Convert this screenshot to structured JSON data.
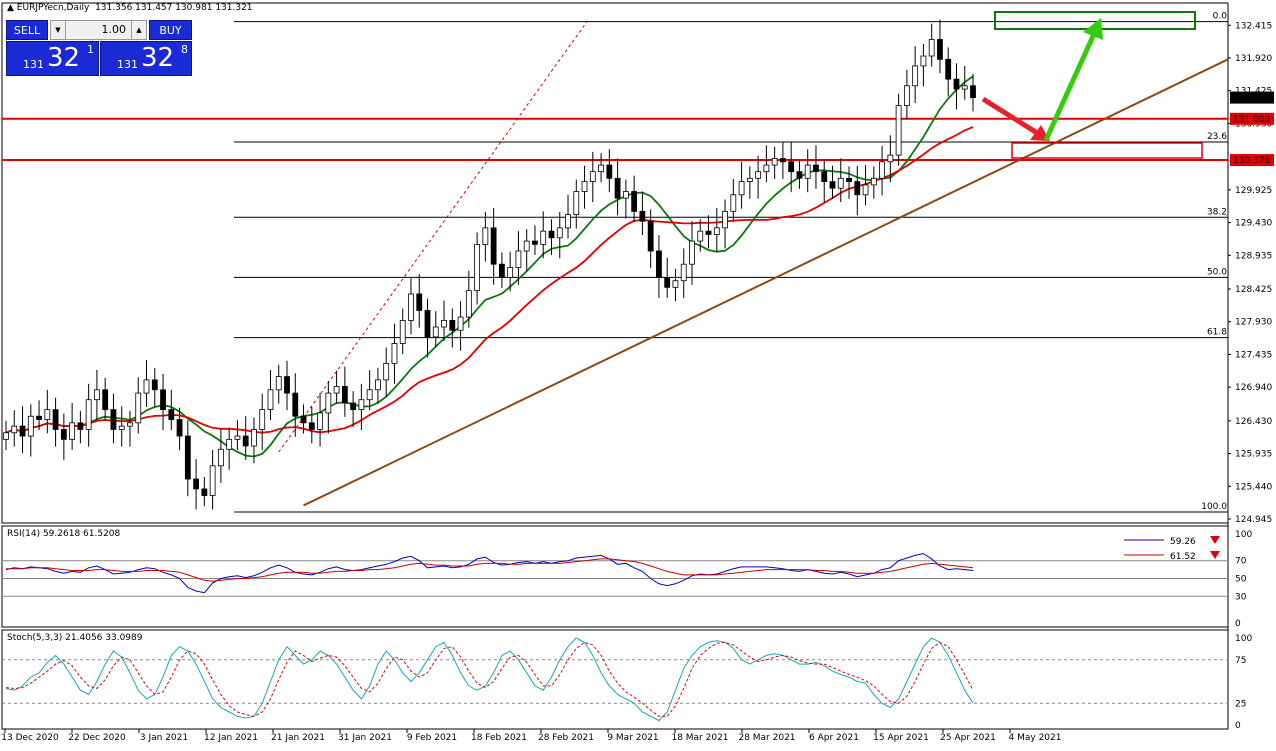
{
  "header": {
    "symbol": "EURJPYecn,Daily",
    "ohlc": "131.356 131.457 130.981 131.321"
  },
  "trade_panel": {
    "sell_label": "SELL",
    "buy_label": "BUY",
    "lot_value": "1.00",
    "bid_prefix": "131",
    "bid_big": "32",
    "bid_sup": "1",
    "ask_prefix": "131",
    "ask_big": "32",
    "ask_sup": "8"
  },
  "chart_data": [
    {
      "type": "candlestick",
      "name": "main",
      "y_ticks": [
        "132.415",
        "131.920",
        "131.425",
        "130.930",
        "129.925",
        "129.430",
        "128.935",
        "128.425",
        "127.930",
        "127.435",
        "126.940",
        "126.430",
        "125.935",
        "125.440",
        "124.945"
      ],
      "ylim": [
        124.9,
        132.6
      ],
      "x_ticks": [
        "13 Dec 2020",
        "22 Dec 2020",
        "3 Jan 2021",
        "12 Jan 2021",
        "21 Jan 2021",
        "31 Jan 2021",
        "9 Feb 2021",
        "18 Feb 2021",
        "28 Feb 2021",
        "9 Mar 2021",
        "18 Mar 2021",
        "28 Mar 2021",
        "6 Apr 2021",
        "15 Apr 2021",
        "25 Apr 2021",
        "4 May 2021"
      ],
      "last_price": "131.321",
      "close": [
        126.25,
        126.35,
        126.2,
        126.5,
        126.45,
        126.6,
        126.3,
        126.15,
        126.4,
        126.3,
        126.75,
        126.9,
        126.6,
        126.3,
        126.35,
        126.4,
        126.85,
        127.05,
        126.9,
        126.6,
        126.45,
        126.2,
        125.55,
        125.4,
        125.3,
        125.75,
        126.0,
        126.15,
        126.2,
        126.05,
        126.3,
        126.6,
        126.9,
        127.1,
        126.85,
        126.5,
        126.4,
        126.3,
        126.55,
        126.85,
        126.95,
        126.7,
        126.6,
        126.75,
        126.9,
        127.05,
        127.3,
        127.6,
        127.95,
        128.35,
        128.1,
        127.7,
        127.85,
        127.95,
        127.8,
        128.0,
        128.4,
        129.1,
        129.35,
        128.8,
        128.6,
        128.75,
        129.0,
        129.15,
        129.1,
        129.3,
        129.2,
        129.35,
        129.55,
        129.9,
        130.05,
        130.2,
        130.3,
        130.1,
        129.8,
        129.9,
        129.6,
        129.45,
        129.0,
        128.6,
        128.45,
        128.55,
        128.8,
        129.15,
        129.3,
        129.25,
        129.35,
        129.6,
        129.85,
        130.05,
        130.1,
        130.2,
        130.3,
        130.4,
        130.35,
        130.2,
        130.1,
        130.3,
        130.2,
        130.05,
        129.95,
        130.1,
        130.05,
        129.85,
        130.0,
        130.1,
        130.35,
        130.45,
        131.2,
        131.5,
        131.8,
        131.95,
        132.2,
        131.9,
        131.6,
        131.45,
        131.5,
        131.32
      ],
      "lines": {
        "fib_levels": [
          {
            "label": "0.0",
            "price": 132.47
          },
          {
            "label": "23.6",
            "price": 130.65
          },
          {
            "label": "38.2",
            "price": 129.51
          },
          {
            "label": "50.0",
            "price": 128.6
          },
          {
            "label": "61.8",
            "price": 127.69
          },
          {
            "label": "100.0",
            "price": 125.05
          }
        ],
        "horizontal_levels": [
          {
            "label": "131.000",
            "price": 131.0,
            "color": "#e00000"
          },
          {
            "label": "130.376",
            "price": 130.376,
            "color": "#e00000"
          }
        ],
        "colors": {
          "ma_fast": "#0a7a0a",
          "ma_slow": "#e00000",
          "trendline": "#8a4a1a",
          "arrow_up": "#33cc11",
          "arrow_down": "#e8202a",
          "bull_candle": "#ffffff",
          "bear_candle": "#000000"
        }
      }
    },
    {
      "type": "line",
      "name": "RSI",
      "title": "RSI(14) 59.2618 61.5208",
      "levels": [
        70,
        50,
        30
      ],
      "y_ticks": [
        "100",
        "70",
        "50",
        "30",
        "0"
      ],
      "ylim": [
        0,
        100
      ],
      "legend": [
        {
          "value": "59.26",
          "color": "#0000cc"
        },
        {
          "value": "61.52",
          "color": "#cc0000"
        }
      ],
      "series": [
        {
          "values": [
            60,
            62,
            61,
            63,
            62,
            61,
            58,
            56,
            58,
            57,
            62,
            64,
            60,
            55,
            56,
            57,
            60,
            62,
            61,
            57,
            54,
            50,
            40,
            36,
            34,
            45,
            50,
            52,
            53,
            51,
            53,
            57,
            62,
            65,
            62,
            57,
            55,
            54,
            57,
            61,
            63,
            60,
            59,
            60,
            62,
            64,
            66,
            69,
            73,
            75,
            70,
            62,
            63,
            64,
            62,
            63,
            66,
            72,
            74,
            68,
            65,
            66,
            68,
            69,
            67,
            69,
            67,
            69,
            70,
            73,
            74,
            75,
            76,
            72,
            66,
            67,
            62,
            58,
            50,
            44,
            42,
            44,
            48,
            53,
            55,
            54,
            55,
            58,
            61,
            63,
            63,
            63,
            63,
            62,
            61,
            59,
            58,
            60,
            58,
            56,
            55,
            57,
            55,
            52,
            54,
            56,
            60,
            62,
            70,
            73,
            76,
            78,
            72,
            64,
            60,
            61,
            60,
            59
          ]
        },
        {
          "values": [
            61,
            61,
            61,
            62,
            62,
            62,
            61,
            60,
            59,
            59,
            59,
            60,
            60,
            59,
            58,
            58,
            58,
            59,
            59,
            59,
            58,
            57,
            54,
            51,
            48,
            47,
            48,
            49,
            50,
            50,
            51,
            52,
            54,
            56,
            57,
            57,
            57,
            56,
            56,
            57,
            58,
            58,
            59,
            59,
            60,
            60,
            61,
            62,
            64,
            66,
            67,
            66,
            65,
            65,
            64,
            64,
            64,
            66,
            67,
            67,
            67,
            66,
            66,
            67,
            67,
            67,
            67,
            67,
            68,
            69,
            70,
            71,
            72,
            72,
            71,
            70,
            69,
            67,
            64,
            61,
            58,
            56,
            54,
            54,
            54,
            54,
            54,
            55,
            56,
            57,
            58,
            59,
            60,
            60,
            60,
            60,
            60,
            60,
            59,
            59,
            58,
            58,
            57,
            56,
            56,
            56,
            57,
            58,
            60,
            62,
            64,
            66,
            67,
            66,
            65,
            64,
            63,
            62
          ]
        }
      ]
    },
    {
      "type": "line",
      "name": "Stochastic",
      "title": "Stoch(5,3,3) 21.4056 33.0989",
      "levels": [
        75,
        25
      ],
      "y_ticks": [
        "100",
        "75",
        "25",
        "0"
      ],
      "ylim": [
        0,
        100
      ],
      "series": [
        {
          "values": [
            42,
            40,
            45,
            55,
            60,
            72,
            80,
            70,
            55,
            40,
            35,
            50,
            70,
            85,
            78,
            60,
            40,
            30,
            35,
            55,
            80,
            90,
            85,
            70,
            50,
            30,
            20,
            15,
            10,
            8,
            10,
            25,
            50,
            75,
            90,
            80,
            70,
            75,
            85,
            80,
            70,
            55,
            40,
            30,
            45,
            70,
            85,
            75,
            60,
            50,
            60,
            75,
            90,
            95,
            80,
            60,
            45,
            40,
            45,
            60,
            80,
            85,
            75,
            60,
            45,
            40,
            55,
            75,
            90,
            100,
            95,
            80,
            60,
            45,
            35,
            30,
            25,
            15,
            10,
            5,
            15,
            40,
            65,
            80,
            90,
            95,
            97,
            95,
            88,
            75,
            70,
            75,
            80,
            82,
            80,
            75,
            70,
            70,
            72,
            68,
            62,
            58,
            55,
            50,
            48,
            35,
            25,
            20,
            30,
            50,
            70,
            90,
            100,
            95,
            80,
            60,
            40,
            25
          ]
        },
        {
          "values": [
            43,
            42,
            43,
            48,
            55,
            62,
            70,
            74,
            68,
            55,
            45,
            42,
            52,
            68,
            78,
            75,
            60,
            45,
            35,
            38,
            55,
            75,
            85,
            82,
            70,
            52,
            35,
            22,
            15,
            12,
            10,
            15,
            30,
            52,
            72,
            85,
            80,
            73,
            77,
            80,
            78,
            68,
            55,
            42,
            38,
            48,
            65,
            78,
            75,
            62,
            55,
            60,
            75,
            88,
            90,
            78,
            62,
            48,
            43,
            50,
            65,
            78,
            80,
            72,
            58,
            45,
            45,
            58,
            75,
            88,
            95,
            92,
            80,
            62,
            48,
            38,
            32,
            25,
            17,
            10,
            10,
            22,
            42,
            65,
            80,
            88,
            94,
            95,
            92,
            85,
            78,
            73,
            75,
            78,
            80,
            78,
            74,
            71,
            70,
            70,
            66,
            62,
            58,
            55,
            51,
            45,
            35,
            27,
            25,
            33,
            50,
            70,
            88,
            95,
            90,
            75,
            58,
            40
          ]
        }
      ]
    }
  ]
}
